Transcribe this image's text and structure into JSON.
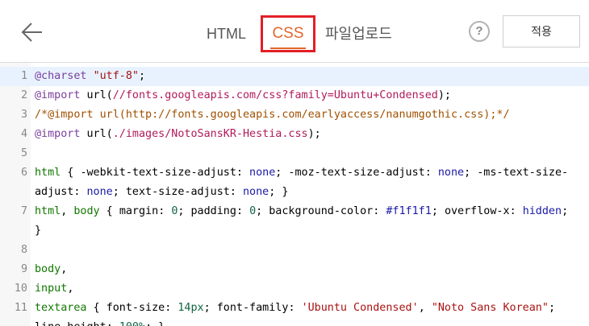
{
  "header": {
    "tabs": [
      {
        "label": "HTML"
      },
      {
        "label": "CSS"
      },
      {
        "label": "파일업로드"
      }
    ],
    "help_label": "?",
    "apply_label": "적용",
    "active_tab": "CSS",
    "accent_color": "#e0662c",
    "highlight_box_color": "#e21f26"
  },
  "editor": {
    "lines": [
      {
        "n": "1",
        "parts": [
          [
            "kw",
            "@charset"
          ],
          [
            "plain",
            " "
          ],
          [
            "str",
            "\"utf-8\""
          ],
          [
            "plain",
            ";"
          ]
        ]
      },
      {
        "n": "2",
        "parts": [
          [
            "kw",
            "@import"
          ],
          [
            "plain",
            " url("
          ],
          [
            "url",
            "//fonts.googleapis.com/css?family=Ubuntu+Condensed"
          ],
          [
            "plain",
            ");"
          ]
        ]
      },
      {
        "n": "3",
        "parts": [
          [
            "cmt",
            "/*@import url(http://fonts.googleapis.com/earlyaccess/nanumgothic.css);*/"
          ]
        ]
      },
      {
        "n": "4",
        "parts": [
          [
            "kw",
            "@import"
          ],
          [
            "plain",
            " url("
          ],
          [
            "url",
            "./images/NotoSansKR-Hestia.css"
          ],
          [
            "plain",
            ");"
          ]
        ]
      },
      {
        "n": "5",
        "parts": []
      },
      {
        "n": "6",
        "parts": [
          [
            "tag",
            "html"
          ],
          [
            "plain",
            " { "
          ],
          [
            "prop",
            "-webkit-text-size-adjust"
          ],
          [
            "plain",
            ": "
          ],
          [
            "val",
            "none"
          ],
          [
            "plain",
            "; "
          ],
          [
            "prop",
            "-moz-text-size-adjust"
          ],
          [
            "plain",
            ": "
          ],
          [
            "val",
            "none"
          ],
          [
            "plain",
            "; "
          ],
          [
            "prop",
            "-ms-text-size-"
          ]
        ]
      },
      {
        "n": "",
        "parts": [
          [
            "prop",
            "adjust"
          ],
          [
            "plain",
            ": "
          ],
          [
            "val",
            "none"
          ],
          [
            "plain",
            "; "
          ],
          [
            "prop",
            "text-size-adjust"
          ],
          [
            "plain",
            ": "
          ],
          [
            "val",
            "none"
          ],
          [
            "plain",
            "; }"
          ]
        ]
      },
      {
        "n": "7",
        "parts": [
          [
            "tag",
            "html"
          ],
          [
            "plain",
            ", "
          ],
          [
            "tag",
            "body"
          ],
          [
            "plain",
            " { "
          ],
          [
            "prop",
            "margin"
          ],
          [
            "plain",
            ": "
          ],
          [
            "num",
            "0"
          ],
          [
            "plain",
            "; "
          ],
          [
            "prop",
            "padding"
          ],
          [
            "plain",
            ": "
          ],
          [
            "num",
            "0"
          ],
          [
            "plain",
            "; "
          ],
          [
            "prop",
            "background-color"
          ],
          [
            "plain",
            ": "
          ],
          [
            "val",
            "#f1f1f1"
          ],
          [
            "plain",
            "; "
          ],
          [
            "prop",
            "overflow-x"
          ],
          [
            "plain",
            ": "
          ],
          [
            "val",
            "hidden"
          ],
          [
            "plain",
            ";"
          ]
        ]
      },
      {
        "n": "",
        "parts": [
          [
            "plain",
            "}"
          ]
        ]
      },
      {
        "n": "8",
        "parts": []
      },
      {
        "n": "9",
        "parts": [
          [
            "tag",
            "body"
          ],
          [
            "plain",
            ","
          ]
        ]
      },
      {
        "n": "10",
        "parts": [
          [
            "tag",
            "input"
          ],
          [
            "plain",
            ","
          ]
        ]
      },
      {
        "n": "11",
        "parts": [
          [
            "tag",
            "textarea"
          ],
          [
            "plain",
            " { "
          ],
          [
            "prop",
            "font-size"
          ],
          [
            "plain",
            ": "
          ],
          [
            "num",
            "14px"
          ],
          [
            "plain",
            "; "
          ],
          [
            "prop",
            "font-family"
          ],
          [
            "plain",
            ": "
          ],
          [
            "strred",
            "'Ubuntu Condensed'"
          ],
          [
            "plain",
            ", "
          ],
          [
            "strred",
            "\"Noto Sans Korean\""
          ],
          [
            "plain",
            ";"
          ]
        ]
      },
      {
        "n": "",
        "parts": [
          [
            "prop",
            "line-height"
          ],
          [
            "plain",
            ": "
          ],
          [
            "num",
            "100%"
          ],
          [
            "plain",
            "; }"
          ]
        ]
      }
    ]
  }
}
